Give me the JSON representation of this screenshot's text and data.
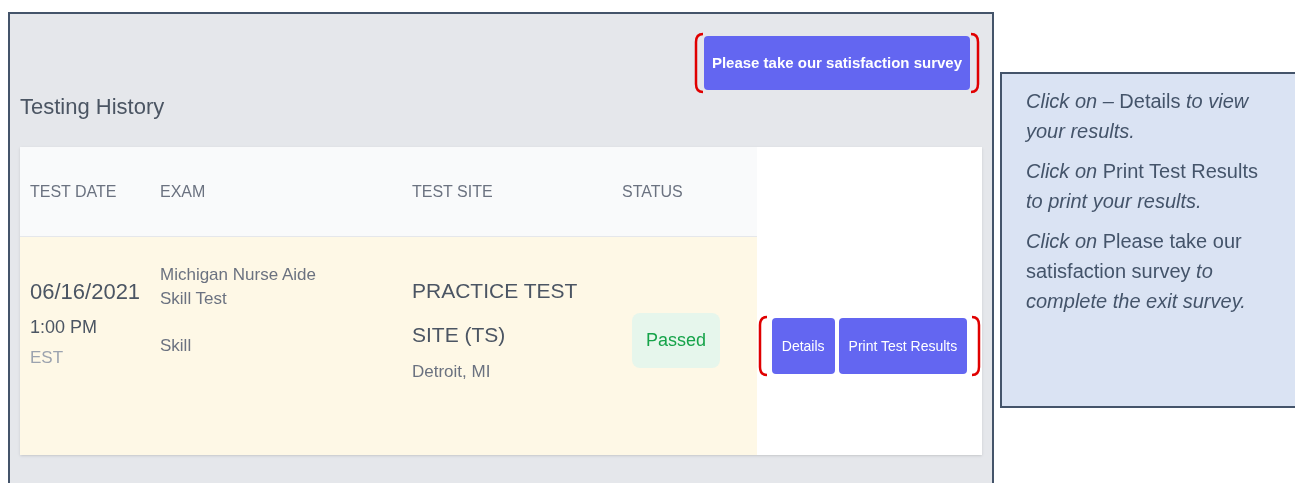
{
  "page": {
    "title": "Testing History",
    "survey_button": "Please take our satisfaction survey"
  },
  "table": {
    "columns": [
      "TEST DATE",
      "EXAM",
      "TEST SITE",
      "STATUS"
    ],
    "rows": [
      {
        "date": "06/16/2021",
        "time": "1:00 PM",
        "timezone": "EST",
        "exam": "Michigan Nurse Aide Skill Test",
        "exam_type": "Skill",
        "site": "PRACTICE TEST SITE (TS)",
        "location": "Detroit, MI",
        "status": "Passed",
        "actions": [
          "Details",
          "Print Test Results"
        ]
      }
    ]
  },
  "callout": {
    "paragraphs": [
      "*Click on –* Details *to view your results.*",
      "*Click on* Print Test Results *to print your results.*",
      "*Click on* Please take our satisfaction survey *to complete the exit survey.*"
    ]
  }
}
